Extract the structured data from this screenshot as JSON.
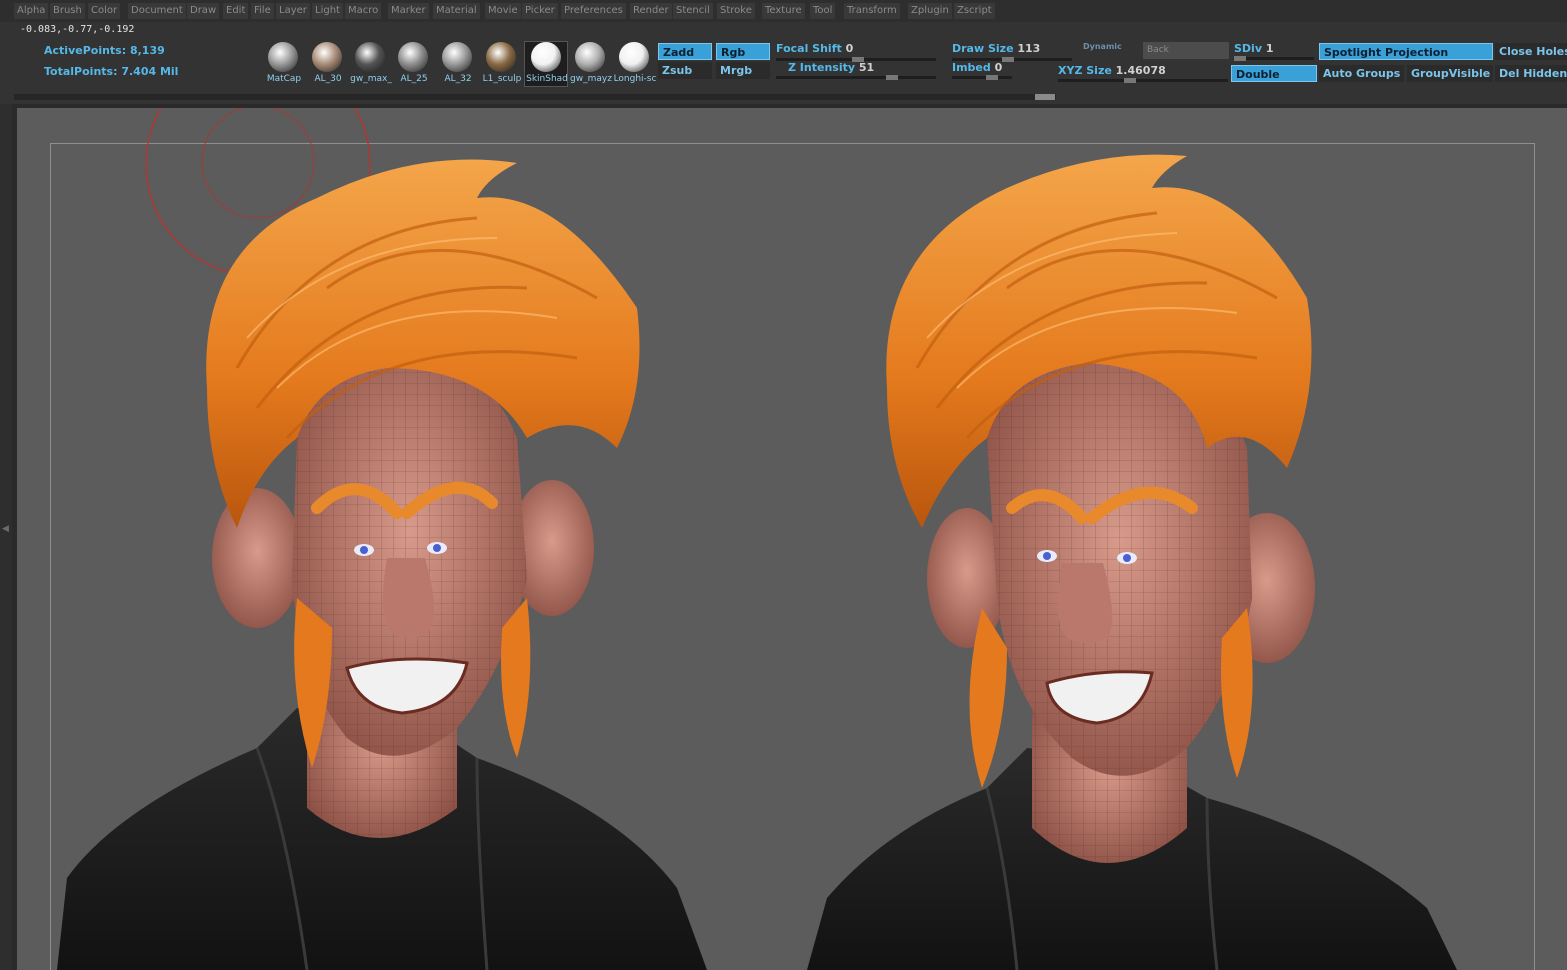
{
  "menu": [
    "Alpha",
    "Brush",
    "Color",
    "Document",
    "Draw",
    "Edit",
    "File",
    "Layer",
    "Light",
    "Macro",
    "Marker",
    "Material",
    "Movie",
    "Picker",
    "Preferences",
    "Render",
    "Stencil",
    "Stroke",
    "Texture",
    "Tool",
    "Transform",
    "Zplugin",
    "Zscript"
  ],
  "status": {
    "coords": "-0.083,-0.77,-0.192",
    "active_points_label": "ActivePoints:",
    "active_points": "8,139",
    "total_points_label": "TotalPoints:",
    "total_points": "7.404 Mil"
  },
  "materials": [
    {
      "label": "MatCap",
      "color": "#9a9a9a",
      "selected": false
    },
    {
      "label": "AL_30",
      "color": "#a98c78",
      "selected": false
    },
    {
      "label": "gw_max_",
      "color": "#555555",
      "selected": false
    },
    {
      "label": "AL_25",
      "color": "#8e8e8e",
      "selected": false
    },
    {
      "label": "AL_32",
      "color": "#9a9a9a",
      "selected": false
    },
    {
      "label": "L1_sculp",
      "color": "#8a6a44",
      "selected": false
    },
    {
      "label": "SkinShad",
      "color": "#f2f2f2",
      "selected": true
    },
    {
      "label": "gw_mayz",
      "color": "#b0b0b0",
      "selected": false
    },
    {
      "label": "Longhi-sc",
      "color": "#f0f0f0",
      "selected": false
    }
  ],
  "toggles": {
    "zadd": "Zadd",
    "zsub": "Zsub",
    "rgb": "Rgb",
    "mrgb": "Mrgb",
    "dynamic": "Dynamic",
    "back": "Back",
    "double": "Double",
    "spotlight": "Spotlight Projection",
    "auto_groups": "Auto Groups",
    "group_visible": "GroupVisible",
    "close_holes": "Close Holes",
    "del_hidden": "Del Hidden"
  },
  "sliders": {
    "focal_shift_label": "Focal Shift",
    "focal_shift": "0",
    "z_intensity_label": "Z Intensity",
    "z_intensity": "51",
    "draw_size_label": "Draw Size",
    "draw_size": "113",
    "imbed_label": "Imbed",
    "imbed": "0",
    "xyz_size_label": "XYZ Size",
    "xyz_size": "1.46078",
    "sdiv_label": "SDiv",
    "sdiv": "1"
  },
  "viewport": {
    "background": "#5c5c5c",
    "scene": "two-character-bust-render"
  }
}
